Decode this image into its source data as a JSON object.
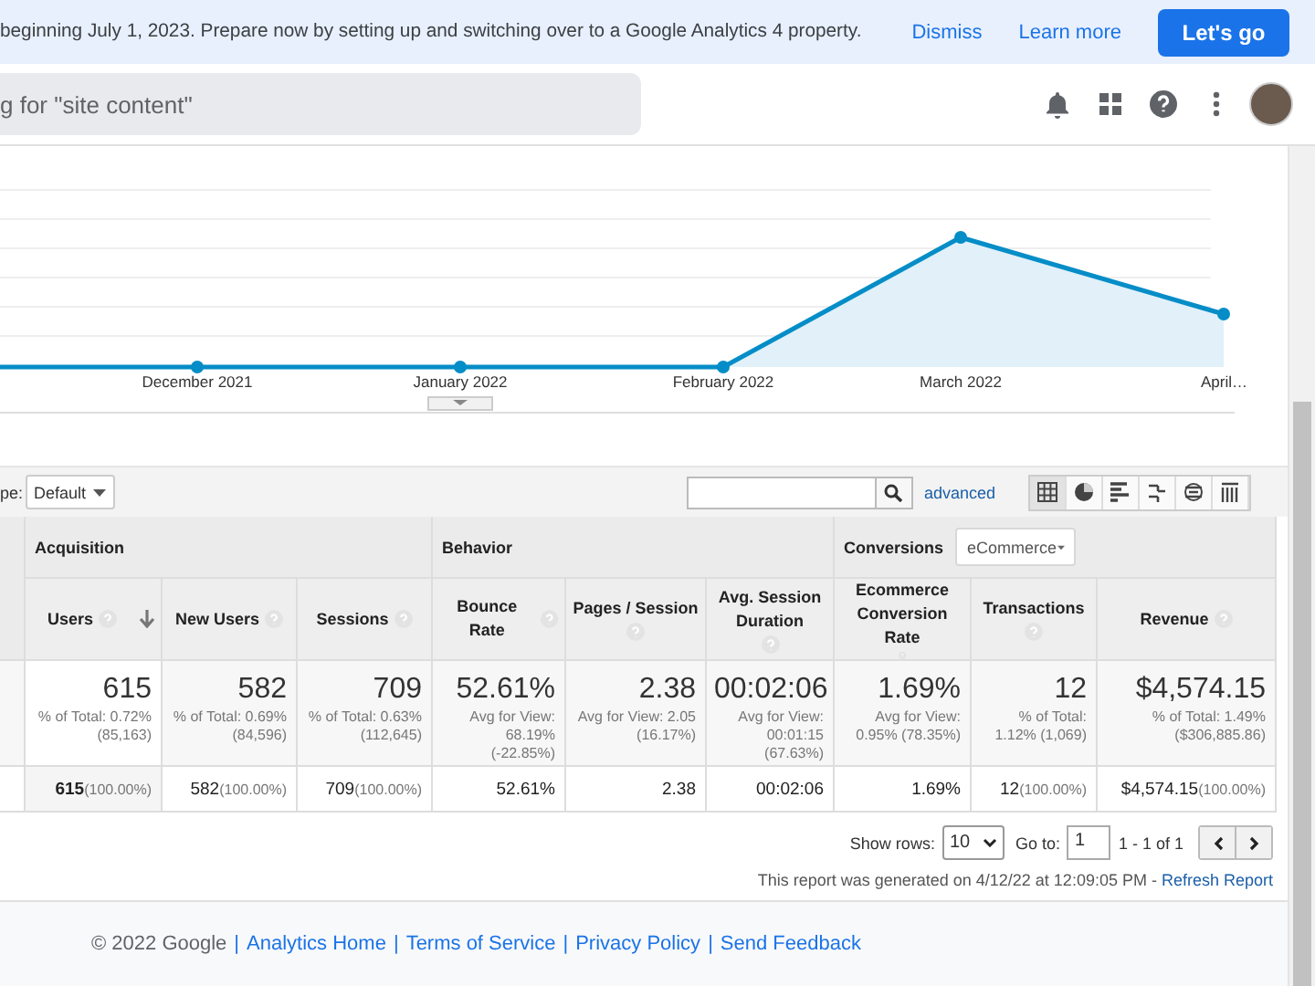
{
  "banner": {
    "message": "beginning July 1, 2023. Prepare now by setting up and switching over to a Google Analytics 4 property.",
    "actions": [
      {
        "label": "Dismiss",
        "kind": "link"
      },
      {
        "label": "Learn more",
        "kind": "link"
      },
      {
        "label": "Let's go",
        "kind": "primary"
      }
    ]
  },
  "header": {
    "search": {
      "placeholder": "g for \"site content\""
    },
    "icons": [
      {
        "kind": "bell"
      },
      {
        "kind": "apps"
      },
      {
        "kind": "help"
      },
      {
        "kind": "more"
      },
      {
        "kind": "avatar"
      }
    ]
  },
  "chart": {
    "x_labels": [
      "December 2021",
      "January 2022",
      "February 2022",
      "March 2022",
      "April…"
    ]
  },
  "toolbar": {
    "type_label": "pe:",
    "type_value": "Default",
    "advanced": "advanced",
    "views": [
      {
        "kind": "table",
        "selected": true
      },
      {
        "kind": "pie",
        "selected": false
      },
      {
        "kind": "bar",
        "selected": false
      },
      {
        "kind": "compare",
        "selected": false
      },
      {
        "kind": "pivot",
        "selected": false
      },
      {
        "kind": "terms",
        "selected": false
      }
    ]
  },
  "table": {
    "groups": [
      {
        "label": "Acquisition",
        "columns": [
          {
            "label": "Users",
            "sorted": true
          },
          {
            "label": "New Users",
            "sorted": false
          },
          {
            "label": "Sessions",
            "sorted": false
          }
        ]
      },
      {
        "label": "Behavior",
        "columns": [
          {
            "label": "Bounce Rate",
            "sorted": false
          },
          {
            "label": "Pages / Session",
            "sorted": false
          },
          {
            "label": "Avg. Session Duration",
            "sorted": false
          }
        ]
      },
      {
        "label": "Conversions",
        "selector": "eCommerce",
        "columns": [
          {
            "label": "Ecommerce Conversion Rate",
            "sorted": false
          },
          {
            "label": "Transactions",
            "sorted": false
          },
          {
            "label": "Revenue",
            "sorted": false
          }
        ]
      }
    ],
    "summary": [
      {
        "value": "615",
        "note": "% of Total: 0.72% (85,163)"
      },
      {
        "value": "582",
        "note": "% of Total: 0.69% (84,596)"
      },
      {
        "value": "709",
        "note": "% of Total: 0.63% (112,645)"
      },
      {
        "value": "52.61%",
        "note": "Avg for View: 68.19% (-22.85%)"
      },
      {
        "value": "2.38",
        "note": "Avg for View: 2.05 (16.17%)"
      },
      {
        "value": "00:02:06",
        "note": "Avg for View: 00:01:15 (67.63%)"
      },
      {
        "value": "1.69%",
        "note": "Avg for View: 0.95% (78.35%)"
      },
      {
        "value": "12",
        "note": "% of Total: 1.12% (1,069)"
      },
      {
        "value": "$4,574.15",
        "note": "% of Total: 1.49% ($306,885.86)"
      }
    ],
    "rows": [
      {
        "cells": [
          {
            "value": "615",
            "share": "(100.00%)"
          },
          {
            "value": "582",
            "share": "(100.00%)"
          },
          {
            "value": "709",
            "share": "(100.00%)"
          },
          {
            "value": "52.61%"
          },
          {
            "value": "2.38"
          },
          {
            "value": "00:02:06"
          },
          {
            "value": "1.69%"
          },
          {
            "value": "12",
            "share": "(100.00%)"
          },
          {
            "value": "$4,574.15",
            "share": "(100.00%)"
          }
        ]
      }
    ]
  },
  "pager": {
    "show_rows_label": "Show rows:",
    "rows_value": "10",
    "goto_label": "Go to:",
    "goto_value": "1",
    "range": "1 - 1 of 1"
  },
  "report": {
    "text": "This report was generated on 4/12/22 at 12:09:05 PM - ",
    "link": "Refresh Report"
  },
  "footer": [
    {
      "kind": "text",
      "text": "© 2022 Google"
    },
    {
      "kind": "sep",
      "text": "|"
    },
    {
      "kind": "link",
      "text": "Analytics Home"
    },
    {
      "kind": "sep",
      "text": "|"
    },
    {
      "kind": "link",
      "text": "Terms of Service"
    },
    {
      "kind": "sep",
      "text": "|"
    },
    {
      "kind": "link",
      "text": "Privacy Policy"
    },
    {
      "kind": "sep",
      "text": "|"
    },
    {
      "kind": "link",
      "text": "Send Feedback"
    }
  ]
}
